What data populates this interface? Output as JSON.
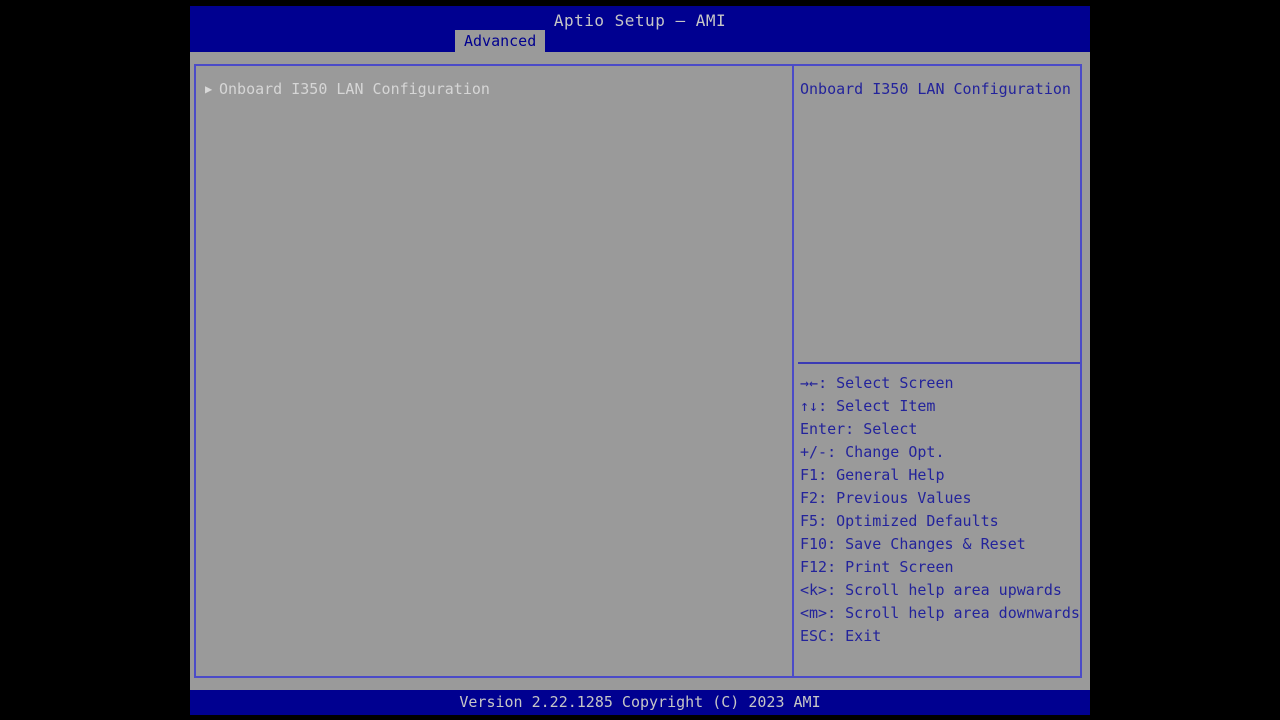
{
  "header": {
    "title": "Aptio Setup – AMI",
    "tabs": [
      {
        "label": "Advanced",
        "active": true
      }
    ]
  },
  "menu": {
    "items": [
      {
        "arrow_icon": "▶",
        "label": "Onboard I350 LAN Configuration",
        "submenu": true,
        "selected": true
      }
    ]
  },
  "help": {
    "text": "Onboard I350 LAN Configuration",
    "legend": [
      {
        "key": "→←",
        "label": ": Select Screen"
      },
      {
        "key": "↑↓",
        "label": ": Select Item"
      },
      {
        "key": "Enter",
        "label": ": Select"
      },
      {
        "key": "+/-",
        "label": ": Change Opt."
      },
      {
        "key": "F1",
        "label": ": General Help"
      },
      {
        "key": "F2",
        "label": ": Previous Values"
      },
      {
        "key": "F5",
        "label": ": Optimized Defaults"
      },
      {
        "key": "F10",
        "label": ": Save Changes & Reset"
      },
      {
        "key": "F12",
        "label": ": Print Screen"
      },
      {
        "key": "<k>",
        "label": ": Scroll help area upwards"
      },
      {
        "key": "<m>",
        "label": ": Scroll help area downwards"
      },
      {
        "key": "ESC",
        "label": ": Exit"
      }
    ]
  },
  "footer": {
    "version_text": "Version 2.22.1285 Copyright (C) 2023 AMI"
  },
  "colors": {
    "header_blue": "#000090",
    "panel_gray": "#9a9a9a",
    "border_blue": "#4b4bc8",
    "help_text_blue": "#23239b",
    "menu_text": "#d6d6d6",
    "title_text": "#c6c6c6"
  }
}
